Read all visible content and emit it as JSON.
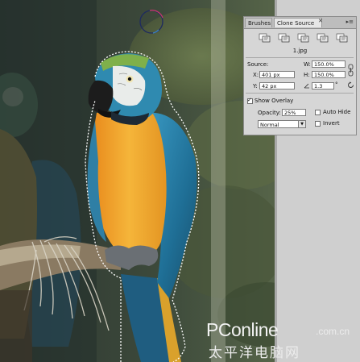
{
  "panel": {
    "tabs": [
      "Brushes",
      "Clone Source"
    ],
    "close_glyph": "✕",
    "menu_glyph": "▸≡",
    "clone_source_icons": [
      "clone-source-1-icon",
      "clone-source-2-icon",
      "clone-source-3-icon",
      "clone-source-4-icon",
      "clone-source-5-icon"
    ],
    "file_label": "1.jpg",
    "source_label": "Source:",
    "x_label": "X:",
    "x_value": "401 px",
    "y_label": "Y:",
    "y_value": "42 px",
    "w_label": "W:",
    "w_value": "150.0%",
    "h_label": "H:",
    "h_value": "150.0%",
    "angle_value": "1.3",
    "angle_unit": "°",
    "show_overlay_label": "Show Overlay",
    "show_overlay_checked": true,
    "opacity_label": "Opacity:",
    "opacity_value": "25%",
    "auto_hide_label": "Auto Hide",
    "auto_hide_checked": false,
    "mode_value": "Normal",
    "invert_label": "Invert",
    "invert_checked": false
  },
  "watermark": {
    "brand": "PConline",
    "domain": ".com.cn",
    "chinese": "太平洋电脑网"
  },
  "colors": {
    "panel_bg": "#d6d6d6",
    "parrot_blue": "#2d7fa8",
    "parrot_yellow": "#f0a630"
  }
}
